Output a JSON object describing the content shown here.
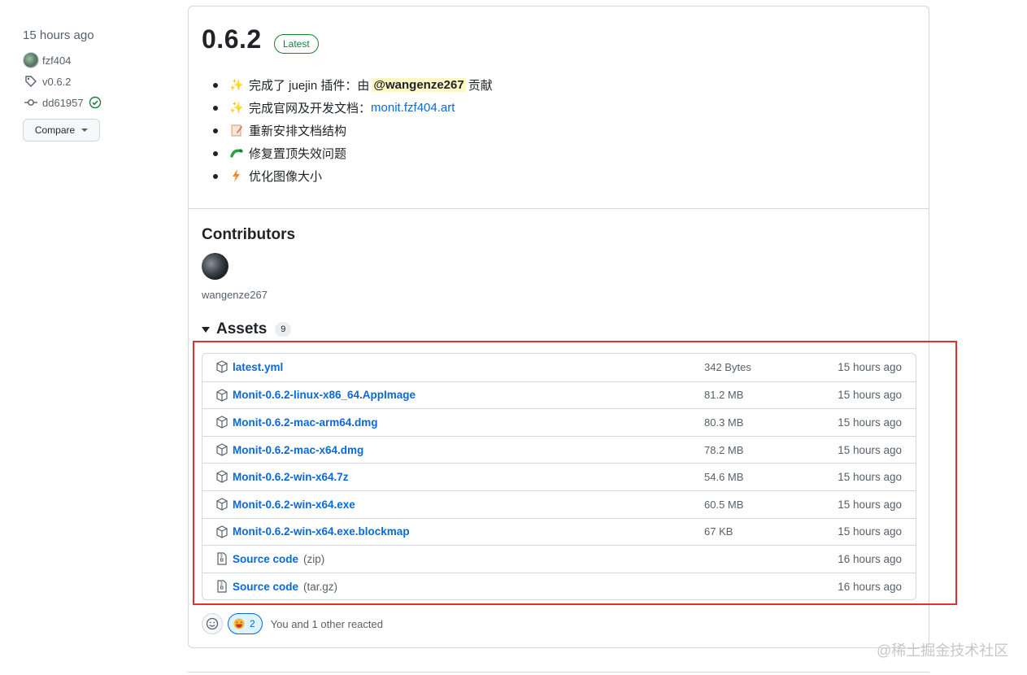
{
  "sidebar": {
    "time": "15 hours ago",
    "author": "fzf404",
    "tag": "v0.6.2",
    "commit": "dd61957",
    "compare_label": "Compare"
  },
  "release": {
    "title": "0.6.2",
    "badge": "Latest",
    "notes": [
      {
        "emoji": "sparkles-icon",
        "prefix": "完成了 juejin 插件：由",
        "mention": "@wangenze267",
        "suffix": "贡献"
      },
      {
        "emoji": "sparkles-icon",
        "prefix": "完成官网及开发文档：",
        "link": "monit.fzf404.art"
      },
      {
        "emoji": "memo-icon",
        "prefix": "重新安排文档结构"
      },
      {
        "emoji": "bug-icon",
        "prefix": "修复置顶失效问题"
      },
      {
        "emoji": "zap-icon",
        "prefix": "优化图像大小"
      }
    ]
  },
  "contributors": {
    "title": "Contributors",
    "names": [
      "wangenze267"
    ]
  },
  "assets": {
    "title": "Assets",
    "count": "9",
    "rows": [
      {
        "name": "latest.yml",
        "ext": "",
        "size": "342 Bytes",
        "time": "15 hours ago",
        "icon": "package-icon"
      },
      {
        "name": "Monit-0.6.2-linux-x86_64.AppImage",
        "ext": "",
        "size": "81.2 MB",
        "time": "15 hours ago",
        "icon": "package-icon"
      },
      {
        "name": "Monit-0.6.2-mac-arm64.dmg",
        "ext": "",
        "size": "80.3 MB",
        "time": "15 hours ago",
        "icon": "package-icon"
      },
      {
        "name": "Monit-0.6.2-mac-x64.dmg",
        "ext": "",
        "size": "78.2 MB",
        "time": "15 hours ago",
        "icon": "package-icon"
      },
      {
        "name": "Monit-0.6.2-win-x64.7z",
        "ext": "",
        "size": "54.6 MB",
        "time": "15 hours ago",
        "icon": "package-icon"
      },
      {
        "name": "Monit-0.6.2-win-x64.exe",
        "ext": "",
        "size": "60.5 MB",
        "time": "15 hours ago",
        "icon": "package-icon"
      },
      {
        "name": "Monit-0.6.2-win-x64.exe.blockmap",
        "ext": "",
        "size": "67 KB",
        "time": "15 hours ago",
        "icon": "package-icon"
      },
      {
        "name": "Source code",
        "ext": "(zip)",
        "size": "",
        "time": "16 hours ago",
        "icon": "file-zip-icon"
      },
      {
        "name": "Source code",
        "ext": "(tar.gz)",
        "size": "",
        "time": "16 hours ago",
        "icon": "file-zip-icon"
      }
    ]
  },
  "reactions": {
    "count": "2",
    "text": "You and 1 other reacted"
  },
  "watermark": "@稀土掘金技术社区",
  "colors": {
    "link": "#0969da",
    "highlight": "#e03131",
    "success": "#1a7f37"
  }
}
